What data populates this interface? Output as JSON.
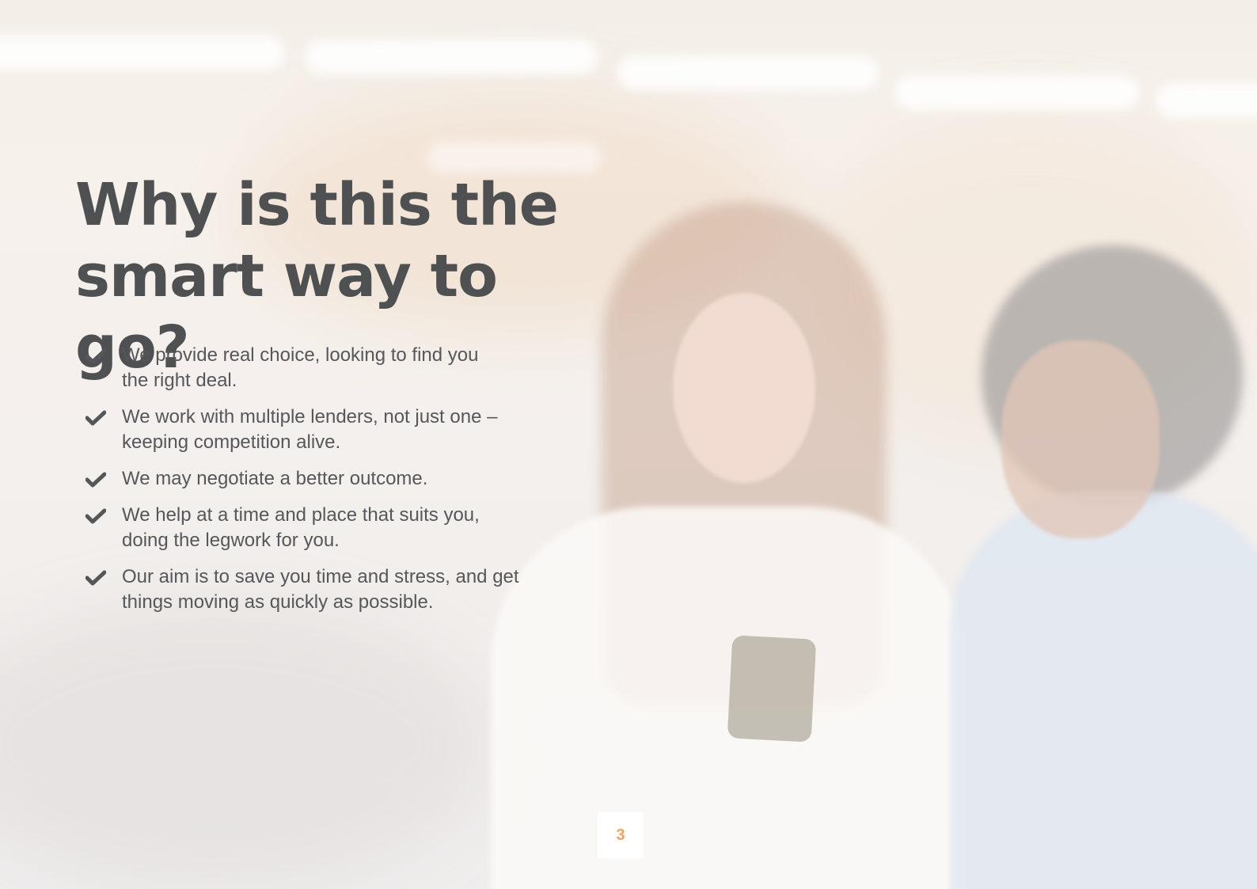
{
  "heading": {
    "line1": "Why is this the",
    "line2": "smart way to go?"
  },
  "bullets": [
    {
      "line1": "We provide real choice, looking to find you",
      "line2": "the right deal."
    },
    {
      "line1": "We work with multiple lenders, not just one –",
      "line2": "keeping competition alive."
    },
    {
      "line1": "We may negotiate a better outcome.",
      "line2": ""
    },
    {
      "line1": "We help at a time and place that suits you,",
      "line2": "doing the legwork for you."
    },
    {
      "line1": "Our aim is to save you time and stress, and get",
      "line2": "things moving as quickly as possible."
    }
  ],
  "icons": {
    "bullet": "checkmark-icon"
  },
  "page_number": "3",
  "colors": {
    "heading": "#4f5052",
    "body_text": "#56575a",
    "accent": "#f0a15f"
  }
}
